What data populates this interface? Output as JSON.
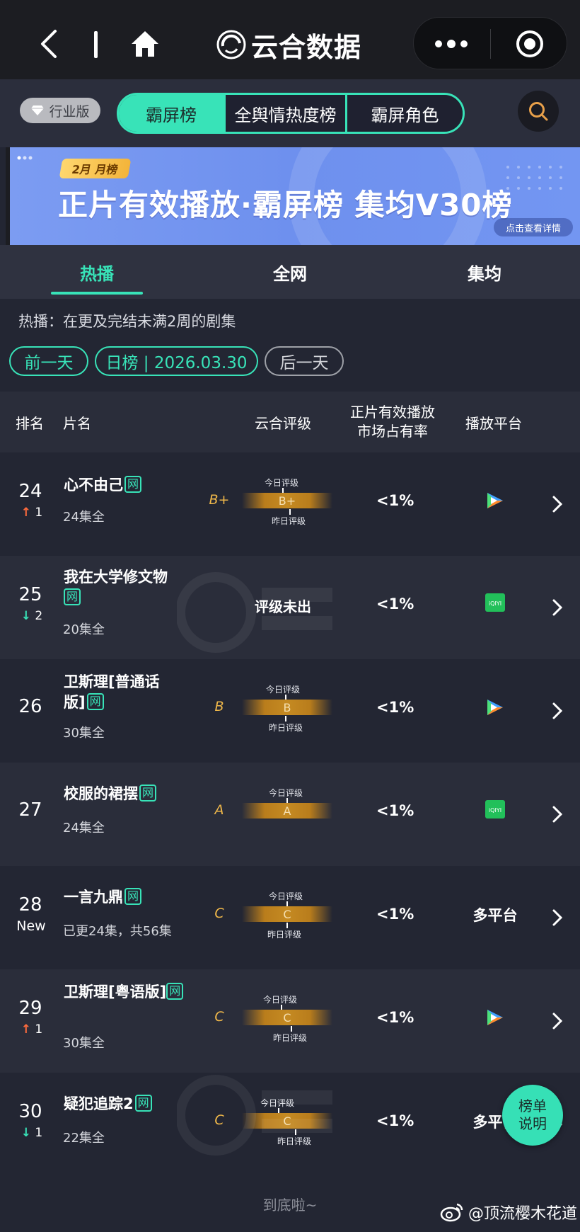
{
  "app": {
    "brand": "云合数据"
  },
  "header": {
    "industry_badge": "行业版",
    "tabs": [
      "霸屏榜",
      "全舆情热度榜",
      "霸屏角色"
    ]
  },
  "banner": {
    "month_tag": "2月 月榜",
    "title": "正片有效播放·霸屏榜 集均V30榜",
    "detail_btn": "点击查看详情"
  },
  "subtabs": [
    "热播",
    "全网",
    "集均"
  ],
  "description": "热播：在更及完结未满2周的剧集",
  "date_nav": {
    "prev": "前一天",
    "current": "日榜 | 2026.03.30",
    "next": "后一天"
  },
  "table": {
    "headers": {
      "rank": "排名",
      "title": "片名",
      "rating": "云合评级",
      "share_line1": "正片有效播放",
      "share_line2": "市场占有率",
      "platform": "播放平台"
    },
    "today_label": "今日评级",
    "yesterday_label": "昨日评级",
    "net_badge": "网",
    "rows": [
      {
        "rank": "24",
        "change": "1",
        "title": "心不由己",
        "episodes": "24集全",
        "grade": "B+",
        "share": "<1%",
        "platform": "tencent-video"
      },
      {
        "rank": "25",
        "change": "2",
        "title": "我在大学修文物",
        "episodes": "20集全",
        "grade_text": "评级未出",
        "share": "<1%",
        "platform": "iqiyi"
      },
      {
        "rank": "26",
        "title": "卫斯理[普通话版]",
        "episodes": "30集全",
        "grade": "B",
        "share": "<1%",
        "platform": "tencent-video"
      },
      {
        "rank": "27",
        "title": "校服的裙摆",
        "episodes": "24集全",
        "grade": "A",
        "share": "<1%",
        "platform": "iqiyi"
      },
      {
        "rank": "28",
        "change": "New",
        "title": "一言九鼎",
        "episodes": "已更24集，共56集",
        "grade": "C",
        "share": "<1%",
        "platform_text": "多平台"
      },
      {
        "rank": "29",
        "change": "1",
        "title": "卫斯理[粤语版]",
        "episodes": "30集全",
        "grade": "C",
        "share": "<1%",
        "platform": "tencent-video"
      },
      {
        "rank": "30",
        "change": "1",
        "title": "疑犯追踪2",
        "episodes": "22集全",
        "grade": "C",
        "share": "<1%",
        "platform_text": "多平台"
      }
    ]
  },
  "footer": {
    "end_text": "到底啦~",
    "float_button": [
      "榜单",
      "说明"
    ],
    "weibo_credit": "@顶流樱木花道"
  },
  "colors": {
    "accent": "#38e3b8",
    "up": "#ff6b3d",
    "grade": "#f0b84a"
  }
}
